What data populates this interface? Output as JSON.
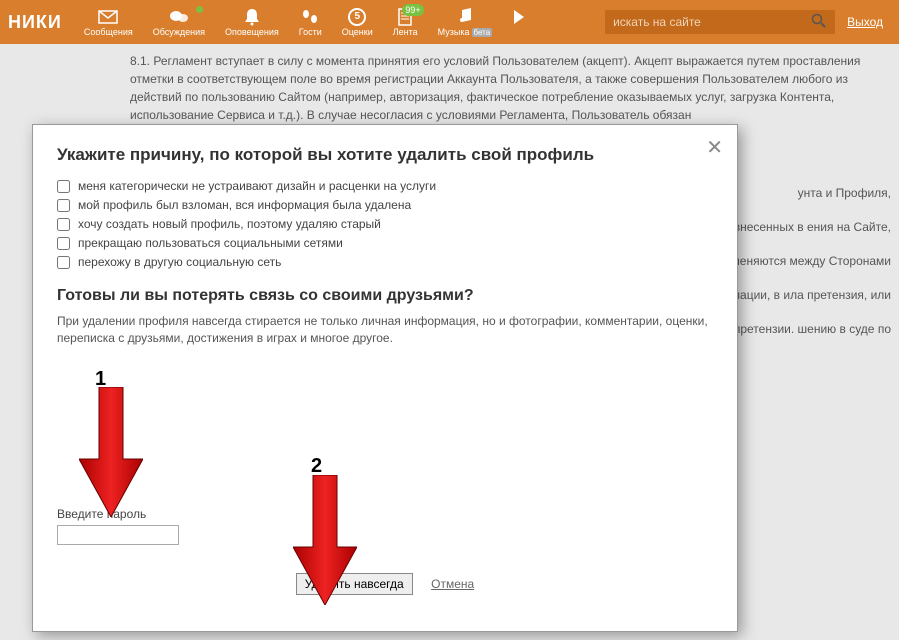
{
  "topbar": {
    "logo_fragment": "НИКИ",
    "nav": [
      {
        "label": "Сообщения"
      },
      {
        "label": "Обсуждения"
      },
      {
        "label": "Оповещения"
      },
      {
        "label": "Гости"
      },
      {
        "label": "Оценки",
        "count": "5"
      },
      {
        "label": "Лента",
        "badge": "99+"
      },
      {
        "label": "Музыка",
        "beta": "бета"
      }
    ],
    "search_placeholder": "искать на сайте",
    "exit": "Выход"
  },
  "background": {
    "p1": "8.1. Регламент вступает в силу с момента принятия его условий Пользователем (акцепт). Акцепт выражается путем проставления отметки в соответствующем поле во время регистрации Аккаунта Пользователя, а также совершения Пользователем любого из действий по пользованию Сайтом (например, авторизация, фактическое потребление оказываемых услуг, загрузка Контента, использование Сервиса и т.д.). В случае несогласия с условиями Регламента, Пользователь обязан",
    "frag1": "унта и Профиля,",
    "frag2": "стороннем порядке о внесенных в ения на Сайте,",
    "frag3": "у, применяются между Сторонами",
    "frag4": "и указания наличие Аккаунтов ий и информации, в ила претензия, или",
    "frag5": "ебный порядок к для досудебного вшему претензии. шению в суде по"
  },
  "modal": {
    "title": "Укажите причину, по которой вы хотите удалить свой профиль",
    "reasons": [
      "меня категорически не устраивают дизайн и расценки на услуги",
      "мой профиль был взломан, вся информация была удалена",
      "хочу создать новый профиль, поэтому удаляю старый",
      "прекращаю пользоваться социальными сетями",
      "перехожу в другую социальную сеть"
    ],
    "subtitle": "Готовы ли вы потерять связь со своими друзьями?",
    "warning": "При удалении профиля навсегда стирается не только личная информация, но и фотографии, комментарии, оценки, переписка с друзьями, достижения в играх и многое другое.",
    "pw_label": "Введите пароль",
    "delete_btn": "Удалить навсегда",
    "cancel": "Отмена"
  },
  "annotations": {
    "arrow1": "1",
    "arrow2": "2"
  }
}
